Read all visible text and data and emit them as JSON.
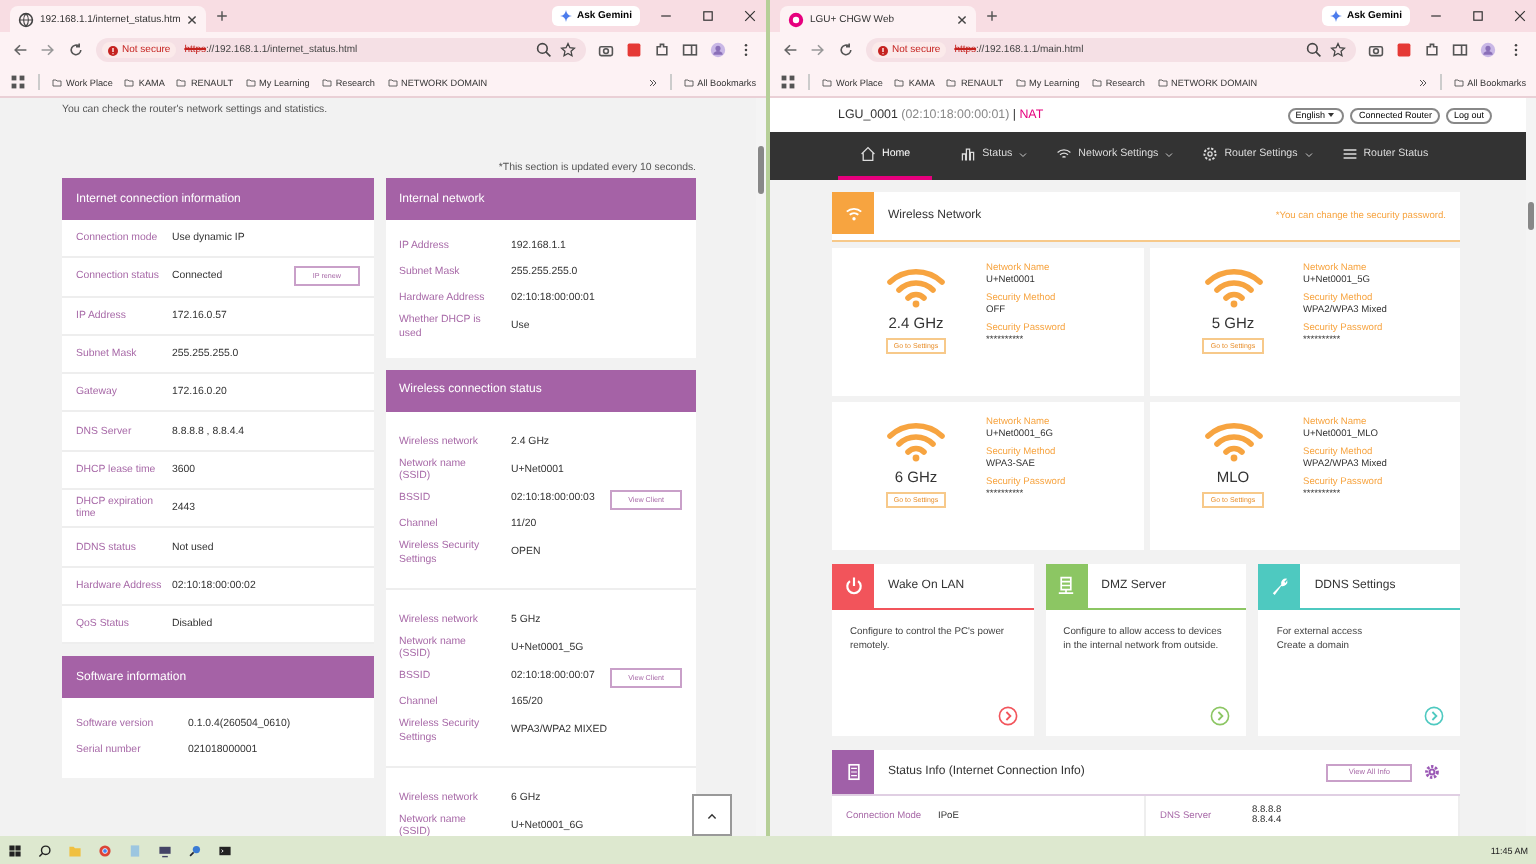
{
  "windows": [
    {
      "kind": "status",
      "tab_title": "192.168.1.1/internet_status.htm",
      "url_scheme": "https",
      "url_path": "://192.168.1.1/internet_status.html",
      "security": "Not secure",
      "gemini": "Ask Gemini",
      "bookmarks": [
        "Work Place",
        "KAMA",
        "RENAULT",
        "My Learning",
        "Research",
        "NETWORK DOMAIN"
      ],
      "all_bookmarks": "All Bookmarks"
    },
    {
      "kind": "router",
      "tab_title": "LGU+ CHGW Web",
      "url_scheme": "https",
      "url_path": "://192.168.1.1/main.html",
      "security": "Not secure",
      "gemini": "Ask Gemini",
      "bookmarks": [
        "Work Place",
        "KAMA",
        "RENAULT",
        "My Learning",
        "Research",
        "NETWORK DOMAIN"
      ],
      "all_bookmarks": "All Bookmarks"
    }
  ],
  "status_page": {
    "intro": "You can check the router's network settings and statistics.",
    "update_note": "*This section is updated every 10 seconds.",
    "internet_connection": {
      "title": "Internet connection information",
      "rows": [
        {
          "label": "Connection mode",
          "value": "Use dynamic IP"
        },
        {
          "label": "Connection status",
          "value": "Connected",
          "button": "IP renew"
        },
        {
          "label": "IP Address",
          "value": "172.16.0.57"
        },
        {
          "label": "Subnet Mask",
          "value": "255.255.255.0"
        },
        {
          "label": "Gateway",
          "value": "172.16.0.20"
        },
        {
          "label": "DNS Server",
          "value": "8.8.8.8 , 8.8.4.4"
        },
        {
          "label": "DHCP lease time",
          "value": "3600"
        },
        {
          "label": "DHCP expiration time",
          "value": "2443"
        },
        {
          "label": "DDNS status",
          "value": "Not used"
        },
        {
          "label": "Hardware Address",
          "value": "02:10:18:00:00:02"
        },
        {
          "label": "QoS Status",
          "value": "Disabled"
        }
      ]
    },
    "software_info": {
      "title": "Software information",
      "rows": [
        {
          "label": "Software version",
          "value": "0.1.0.4(260504_0610)"
        },
        {
          "label": "Serial number",
          "value": "021018000001"
        }
      ]
    },
    "internal_network": {
      "title": "Internal network",
      "rows": [
        {
          "label": "IP Address",
          "value": "192.168.1.1"
        },
        {
          "label": "Subnet Mask",
          "value": "255.255.255.0"
        },
        {
          "label": "Hardware Address",
          "value": "02:10:18:00:00:01"
        },
        {
          "label": "Whether DHCP is used",
          "value": "Use"
        }
      ]
    },
    "wireless_status": {
      "title": "Wireless connection status",
      "groups": [
        {
          "rows": [
            {
              "label": "Wireless network",
              "value": "2.4 GHz"
            },
            {
              "label": "Network name (SSID)",
              "value": "U+Net0001"
            },
            {
              "label": "BSSID",
              "value": "02:10:18:00:00:03",
              "button": "View Client"
            },
            {
              "label": "Channel",
              "value": "11/20"
            },
            {
              "label": "Wireless Security Settings",
              "value": "OPEN"
            }
          ]
        },
        {
          "rows": [
            {
              "label": "Wireless network",
              "value": "5 GHz"
            },
            {
              "label": "Network name (SSID)",
              "value": "U+Net0001_5G"
            },
            {
              "label": "BSSID",
              "value": "02:10:18:00:00:07",
              "button": "View Client"
            },
            {
              "label": "Channel",
              "value": "165/20"
            },
            {
              "label": "Wireless Security Settings",
              "value": "WPA3/WPA2 MIXED"
            }
          ]
        },
        {
          "rows": [
            {
              "label": "Wireless network",
              "value": "6 GHz"
            },
            {
              "label": "Network name (SSID)",
              "value": "U+Net0001_6G"
            }
          ]
        }
      ]
    }
  },
  "router_page": {
    "device": "LGU_0001",
    "mac": "(02:10:18:00:00:01)",
    "separator": "|",
    "mode": "NAT",
    "language": "English",
    "header_buttons": [
      "Connected Router",
      "Log out"
    ],
    "nav": [
      {
        "label": "Home",
        "kind": "home",
        "selected": true,
        "dropdown": false
      },
      {
        "label": "Status",
        "kind": "bars",
        "selected": false,
        "dropdown": true
      },
      {
        "label": "Network Settings",
        "kind": "wifi",
        "selected": false,
        "dropdown": true
      },
      {
        "label": "Router Settings",
        "kind": "gear",
        "selected": false,
        "dropdown": true
      },
      {
        "label": "Router Status",
        "kind": "list",
        "selected": false,
        "dropdown": false
      }
    ],
    "wireless": {
      "title": "Wireless Network",
      "note": "*You can change the security password.",
      "networks": [
        {
          "band": "2.4 GHz",
          "button": "Go to Settings",
          "fields": [
            {
              "label": "Network Name",
              "value": "U+Net0001"
            },
            {
              "label": "Security Method",
              "value": "OFF"
            },
            {
              "label": "Security Password",
              "value": "**********"
            }
          ]
        },
        {
          "band": "5 GHz",
          "button": "Go to Settings",
          "fields": [
            {
              "label": "Network Name",
              "value": "U+Net0001_5G"
            },
            {
              "label": "Security Method",
              "value": "WPA2/WPA3 Mixed"
            },
            {
              "label": "Security Password",
              "value": "**********"
            }
          ]
        },
        {
          "band": "6 GHz",
          "button": "Go to Settings",
          "fields": [
            {
              "label": "Network Name",
              "value": "U+Net0001_6G"
            },
            {
              "label": "Security Method",
              "value": "WPA3-SAE"
            },
            {
              "label": "Security Password",
              "value": "**********"
            }
          ]
        },
        {
          "band": "MLO",
          "button": "Go to Settings",
          "fields": [
            {
              "label": "Network Name",
              "value": "U+Net0001_MLO"
            },
            {
              "label": "Security Method",
              "value": "WPA2/WPA3 Mixed"
            },
            {
              "label": "Security Password",
              "value": "**********"
            }
          ]
        }
      ]
    },
    "features": [
      {
        "title": "Wake On LAN",
        "kind": "power",
        "color": "#f2545b",
        "lines": [
          "Configure to control the PC's power remotely."
        ]
      },
      {
        "title": "DMZ Server",
        "kind": "server",
        "color": "#8cc663",
        "lines": [
          "Configure to allow access to devices in the internal network from outside."
        ]
      },
      {
        "title": "DDNS Settings",
        "kind": "wrench",
        "color": "#4ec9c0",
        "lines": [
          "For external access",
          "Create a domain"
        ]
      }
    ],
    "status_info": {
      "title": "Status Info (Internet Connection Info)",
      "button": "View All Info",
      "rows": [
        {
          "label": "Connection Mode",
          "values": [
            "IPoE"
          ]
        },
        {
          "label": "DNS Server",
          "values": [
            "8.8.8.8",
            "8.8.4.4"
          ]
        }
      ]
    }
  },
  "taskbar": {
    "time": "11:45 AM"
  }
}
